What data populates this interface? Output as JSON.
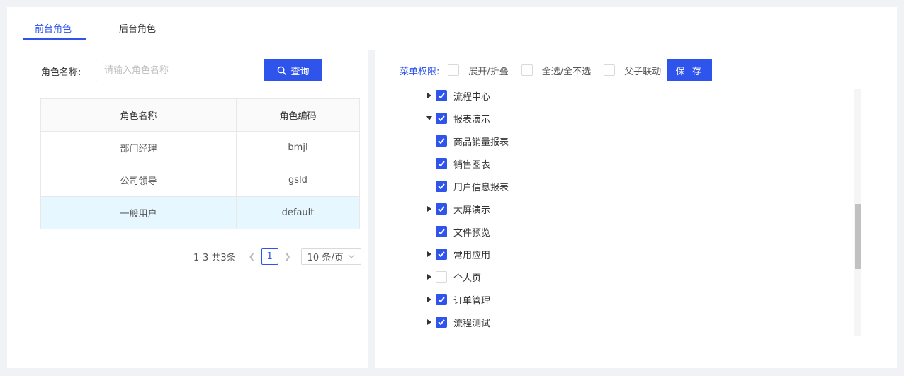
{
  "tabs": [
    {
      "label": "前台角色",
      "active": true
    },
    {
      "label": "后台角色",
      "active": false
    }
  ],
  "search": {
    "label": "角色名称:",
    "placeholder": "请输入角色名称",
    "button_label": "查询",
    "button_icon": "search-icon"
  },
  "table": {
    "columns": [
      "角色名称",
      "角色编码"
    ],
    "rows": [
      {
        "name": "部门经理",
        "code": "bmjl"
      },
      {
        "name": "公司领导",
        "code": "gsld"
      },
      {
        "name": "一般用户",
        "code": "default",
        "selected": true
      }
    ]
  },
  "pagination": {
    "total_text": "1-3 共3条",
    "current_page": "1",
    "page_size": "10 条/页"
  },
  "permissions": {
    "label": "菜单权限:",
    "options": [
      {
        "label": "展开/折叠",
        "checked": false
      },
      {
        "label": "全选/全不选",
        "checked": false
      },
      {
        "label": "父子联动",
        "checked": false
      }
    ],
    "save_label": "保 存"
  },
  "tree": [
    {
      "label": "流程中心",
      "checked": true,
      "caret": "right",
      "level": 0
    },
    {
      "label": "报表演示",
      "checked": true,
      "caret": "down",
      "level": 0
    },
    {
      "label": "商品销量报表",
      "checked": true,
      "caret": "none",
      "level": 1
    },
    {
      "label": "销售图表",
      "checked": true,
      "caret": "none",
      "level": 1
    },
    {
      "label": "用户信息报表",
      "checked": true,
      "caret": "none",
      "level": 1
    },
    {
      "label": "大屏演示",
      "checked": true,
      "caret": "right",
      "level": 0
    },
    {
      "label": "文件预览",
      "checked": true,
      "caret": "none",
      "level": 0
    },
    {
      "label": "常用应用",
      "checked": true,
      "caret": "right",
      "level": 0
    },
    {
      "label": "个人页",
      "checked": false,
      "caret": "right",
      "level": 0
    },
    {
      "label": "订单管理",
      "checked": true,
      "caret": "right",
      "level": 0
    },
    {
      "label": "流程测试",
      "checked": true,
      "caret": "right",
      "level": 0
    }
  ],
  "colors": {
    "accent": "#2f54eb",
    "selected_row": "#e6f7ff",
    "page_bg": "#f0f2f5"
  }
}
